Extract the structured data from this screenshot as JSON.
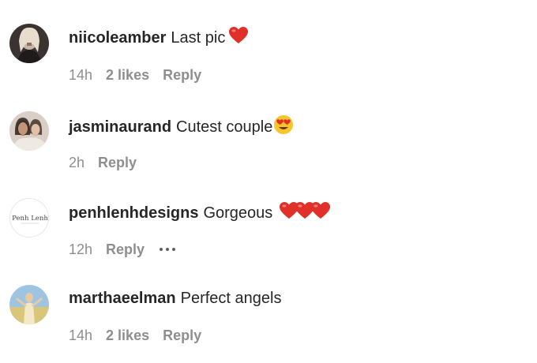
{
  "comments": [
    {
      "username": "niicoleamber",
      "text": "Last pic",
      "time": "14h",
      "likes": "2 likes",
      "reply": "Reply",
      "emoji": "red-heart"
    },
    {
      "username": "jasminaurand",
      "text": "Cutest couple",
      "time": "2h",
      "reply": "Reply",
      "emoji": "heart-eyes"
    },
    {
      "username": "penhlenhdesigns",
      "text": "Gorgeous",
      "time": "12h",
      "reply": "Reply",
      "emoji": "red-heart x3",
      "avatar_text": "Penh Lenh"
    },
    {
      "username": "marthaeelman",
      "text": "Perfect angels",
      "time": "14h",
      "likes": "2 likes",
      "reply": "Reply"
    }
  ],
  "colors": {
    "text": "#262626",
    "meta": "#8e8e8e",
    "heart": "#e0302a"
  }
}
